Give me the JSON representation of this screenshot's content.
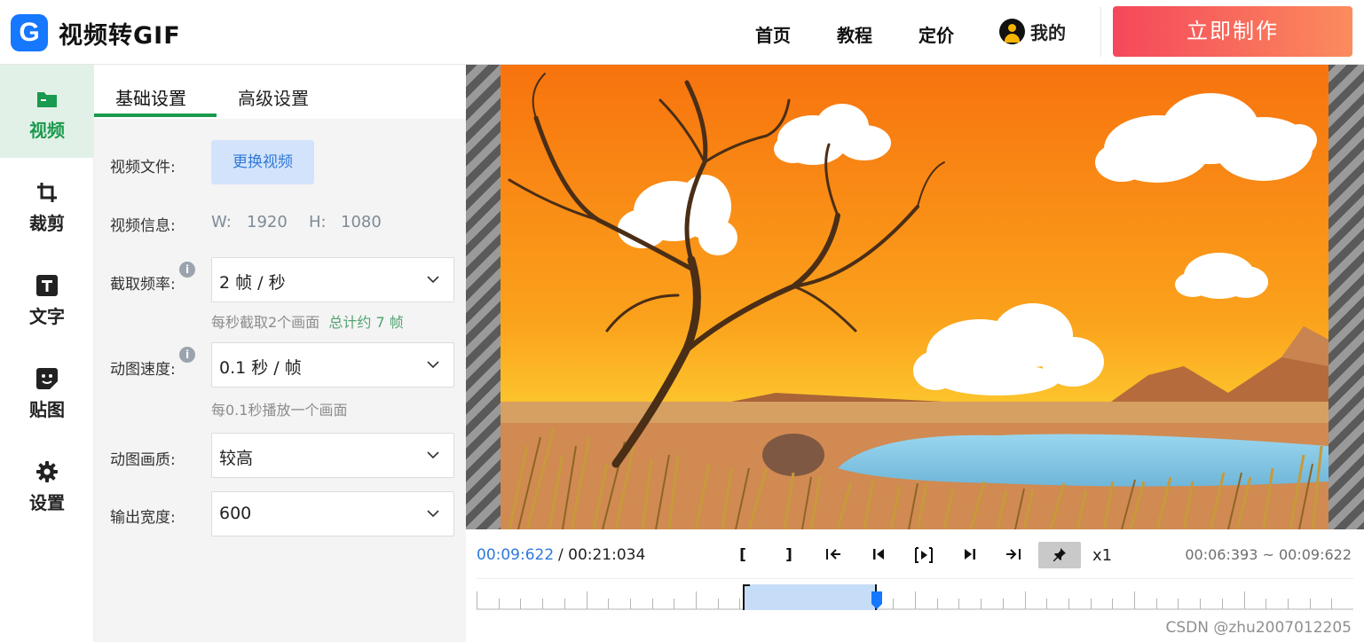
{
  "header": {
    "logo_letter": "G",
    "app_title": "视频转GIF",
    "nav": [
      "首页",
      "教程",
      "定价"
    ],
    "user_label": "我的",
    "cta_label": "立即制作"
  },
  "sidebar": {
    "items": [
      {
        "label": "视频",
        "icon": "folder-icon",
        "active": true
      },
      {
        "label": "裁剪",
        "icon": "crop-icon",
        "active": false
      },
      {
        "label": "文字",
        "icon": "text-icon",
        "active": false
      },
      {
        "label": "贴图",
        "icon": "sticker-icon",
        "active": false
      },
      {
        "label": "设置",
        "icon": "gear-icon",
        "active": false
      }
    ]
  },
  "panel": {
    "tabs": [
      "基础设置",
      "高级设置"
    ],
    "active_tab": 0,
    "video_file": {
      "label": "视频文件:",
      "button": "更换视频"
    },
    "video_info": {
      "label": "视频信息:",
      "w_label": "W:",
      "w_value": "1920",
      "h_label": "H:",
      "h_value": "1080"
    },
    "frame_rate": {
      "label": "截取频率:",
      "value": "2 帧 / 秒",
      "hint": "每秒截取2个画面",
      "total": "总计约 7 帧"
    },
    "speed": {
      "label": "动图速度:",
      "value": "0.1 秒 / 帧",
      "hint": "每0.1秒播放一个画面"
    },
    "quality": {
      "label": "动图画质:",
      "value": "较高"
    },
    "width": {
      "label": "输出宽度:",
      "value": "600"
    }
  },
  "player": {
    "current_time": "00:09:622",
    "total_time": "/ 00:21:034",
    "range": "00:06:393 ~ 00:09:622",
    "speed": "x1",
    "mark_in": "[",
    "mark_out": "]",
    "timeline_selection": {
      "start_fraction": 0.304,
      "end_fraction": 0.456
    },
    "playhead_fraction": 0.456
  },
  "watermark": "CSDN @zhu2007012205",
  "colors": {
    "brand": "#1677ff",
    "accent_green": "#1a9a4e",
    "cta_start": "#f5475b",
    "cta_end": "#fb8c5d",
    "time_blue": "#2f7ad9"
  }
}
